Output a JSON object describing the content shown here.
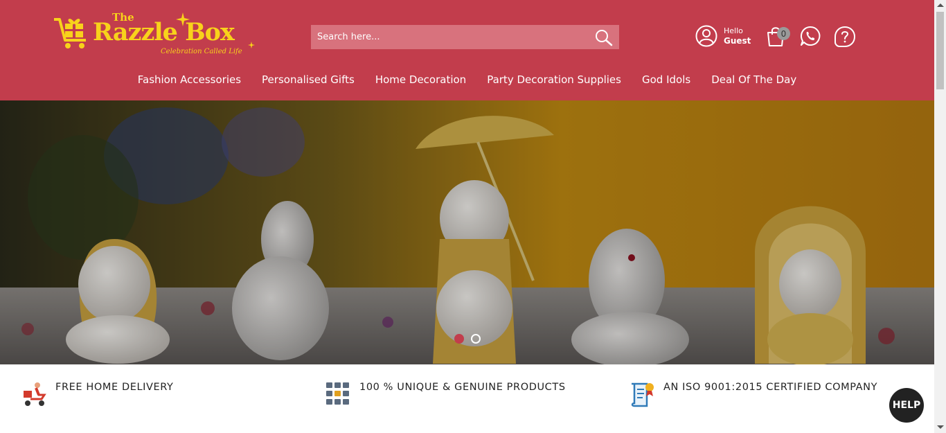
{
  "brand": {
    "the": "The",
    "name": "Razzle Box",
    "tagline": "Celebration Called Life",
    "color": "#f8d21b"
  },
  "header": {
    "background": "#c23d4c"
  },
  "search": {
    "placeholder": "Search here..."
  },
  "user": {
    "hello": "Hello",
    "name": "Guest"
  },
  "cart": {
    "count": "0"
  },
  "nav": {
    "items": [
      {
        "label": "Fashion Accessories"
      },
      {
        "label": "Personalised Gifts"
      },
      {
        "label": "Home Decoration"
      },
      {
        "label": "Party Decoration Supplies"
      },
      {
        "label": "God Idols"
      },
      {
        "label": "Deal Of The Day"
      }
    ]
  },
  "carousel": {
    "active_slide": 1,
    "total_slides": 2
  },
  "features": [
    {
      "icon": "delivery-scooter-icon",
      "label": "FREE HOME DELIVERY"
    },
    {
      "icon": "product-grid-icon",
      "label": "100 % UNIQUE & GENUINE PRODUCTS"
    },
    {
      "icon": "certificate-icon",
      "label": "AN ISO 9001:2015 CERTIFIED COMPANY"
    }
  ],
  "help": {
    "label": "HELP"
  }
}
